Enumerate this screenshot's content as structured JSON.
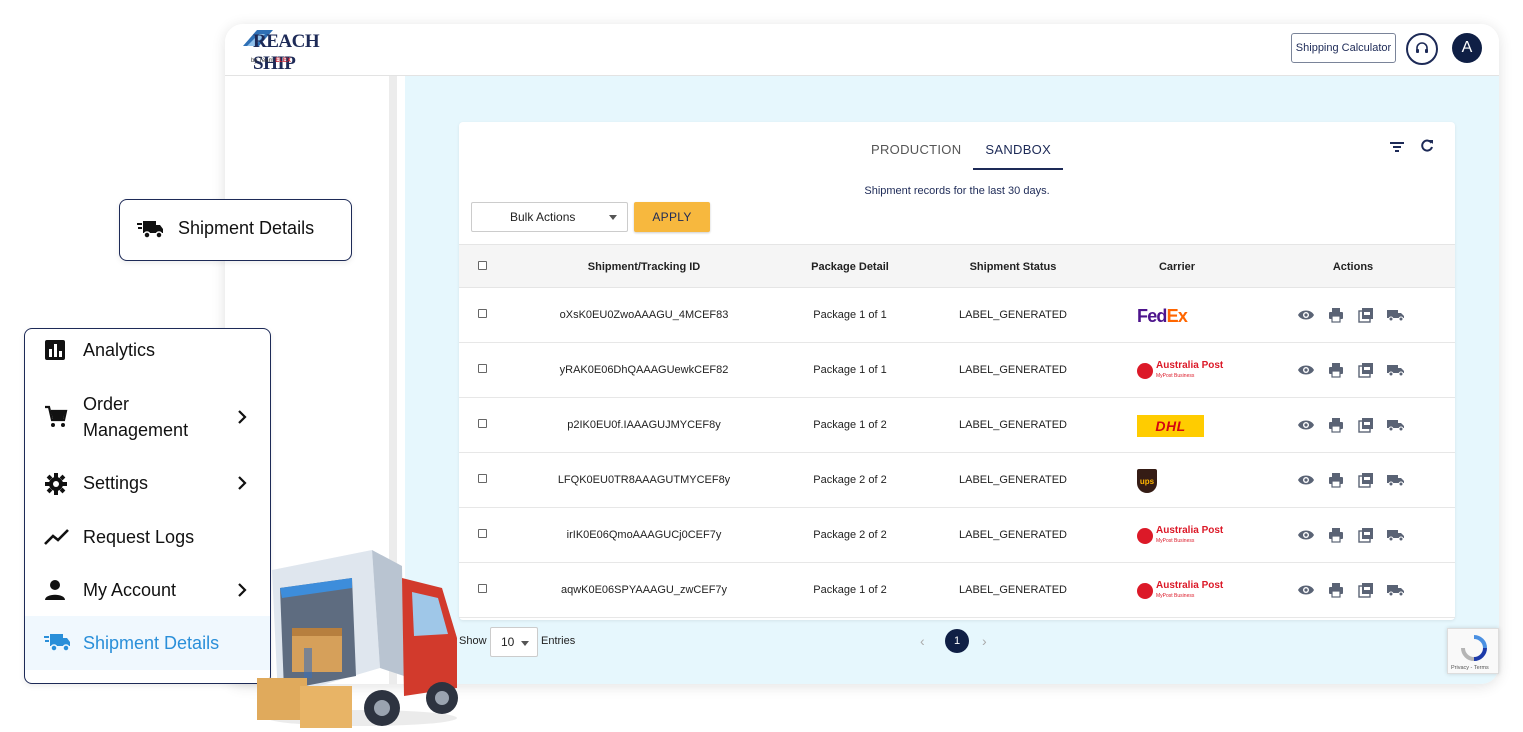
{
  "app": {
    "logo_name": "REACH SHIP",
    "logo_sub_prefix": "by Team",
    "logo_sub_brand": "ELEX",
    "shipping_calculator": "Shipping Calculator",
    "avatar_letter": "A"
  },
  "tabs": [
    {
      "label": "PRODUCTION",
      "active": false
    },
    {
      "label": "SANDBOX",
      "active": true
    }
  ],
  "subtitle": "Shipment records for the last 30 days.",
  "bulk_actions": {
    "selected": "Bulk Actions",
    "apply_label": "APPLY"
  },
  "table": {
    "headers": [
      "Shipment/Tracking ID",
      "Package Detail",
      "Shipment Status",
      "Carrier",
      "Actions"
    ],
    "rows": [
      {
        "id": "oXsK0EU0ZwoAAAGU_4MCEF83",
        "package": "Package 1 of 1",
        "status": "LABEL_GENERATED",
        "carrier": "FedEx"
      },
      {
        "id": "yRAK0E06DhQAAAGUewkCEF82",
        "package": "Package 1 of 1",
        "status": "LABEL_GENERATED",
        "carrier": "Australia Post"
      },
      {
        "id": "p2IK0EU0f.IAAAGUJMYCEF8y",
        "package": "Package 1 of 2",
        "status": "LABEL_GENERATED",
        "carrier": "DHL"
      },
      {
        "id": "LFQK0EU0TR8AAAGUTMYCEF8y",
        "package": "Package 2 of 2",
        "status": "LABEL_GENERATED",
        "carrier": "UPS"
      },
      {
        "id": "irIK0E06QmoAAAGUCj0CEF7y",
        "package": "Package 2 of 2",
        "status": "LABEL_GENERATED",
        "carrier": "Australia Post"
      },
      {
        "id": "aqwK0E06SPYAAAGU_zwCEF7y",
        "package": "Package 1 of 2",
        "status": "LABEL_GENERATED",
        "carrier": "Australia Post"
      }
    ],
    "action_icons": [
      "view-icon",
      "print-icon",
      "pdf-icon",
      "truck-icon"
    ]
  },
  "pagination": {
    "show_label": "Show",
    "page_size": "10",
    "entries_label": "Entries",
    "current_page": "1"
  },
  "carrier_logos": {
    "fedex_fe": "Fed",
    "fedex_ex": "Ex",
    "auspost_main": "Australia Post",
    "auspost_sub": "MyPost Business",
    "dhl": "DHL",
    "ups": "ups"
  },
  "recaptcha": {
    "text": "Privacy - Terms"
  },
  "callout": {
    "label": "Shipment Details"
  },
  "menu": {
    "items": [
      {
        "label": "Analytics"
      },
      {
        "label_line1": "Order",
        "label_line2": "Management"
      },
      {
        "label": "Settings"
      },
      {
        "label": "Request Logs"
      },
      {
        "label": "My Account"
      },
      {
        "label": "Shipment Details"
      }
    ]
  },
  "colors": {
    "navy": "#1d2a57",
    "accent_yellow": "#f7b83e",
    "active_blue": "#2a8fd9",
    "content_bg": "#e6f7fd"
  }
}
